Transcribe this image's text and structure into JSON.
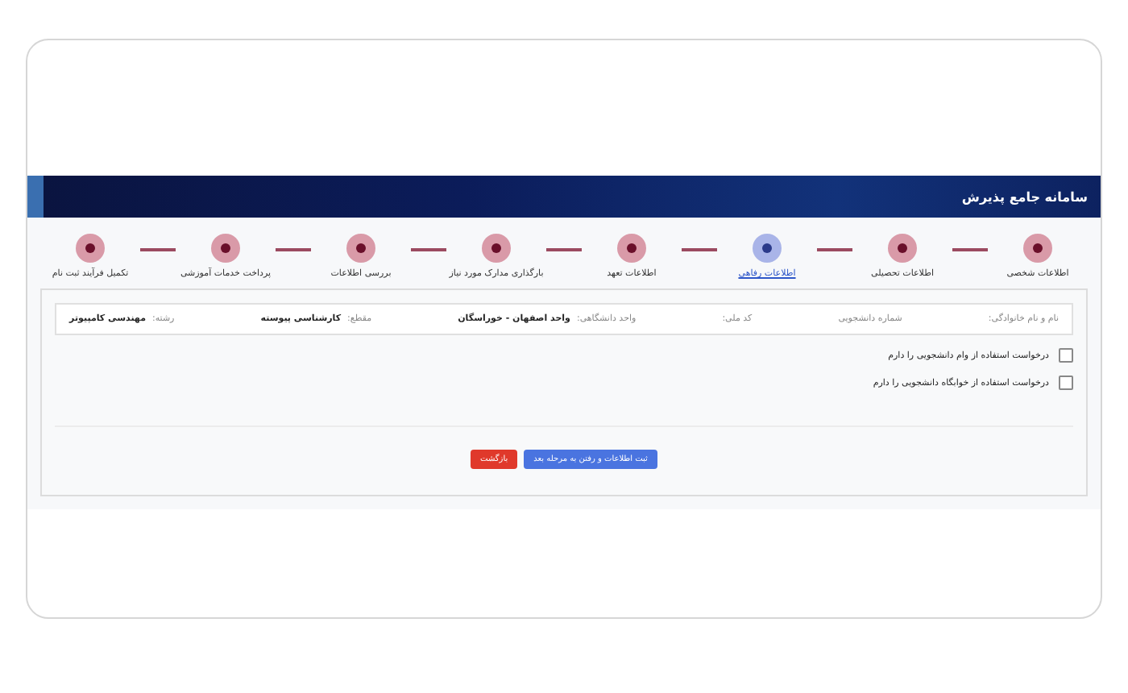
{
  "header": {
    "title": "سامانه جامع پذیرش"
  },
  "steps": [
    {
      "label": "اطلاعات شخصی",
      "selected": false
    },
    {
      "label": "اطلاعات تحصیلی",
      "selected": false
    },
    {
      "label": "اطلاعات رفاهی",
      "selected": true
    },
    {
      "label": "اطلاعات تعهد",
      "selected": false
    },
    {
      "label": "بارگذاری مدارک مورد نیاز",
      "selected": false
    },
    {
      "label": "بررسی اطلاعات",
      "selected": false
    },
    {
      "label": "پرداخت خدمات آموزشی",
      "selected": false
    },
    {
      "label": "تکمیل فرآیند ثبت نام",
      "selected": false
    }
  ],
  "student_info": [
    {
      "label": "نام و نام خانوادگی:"
    },
    {
      "label": "شماره دانشجویی"
    },
    {
      "label": "کد ملی:"
    },
    {
      "label": "واحد دانشگاهی:",
      "value": "واحد اصفهان - خوراسگان"
    },
    {
      "label": "مقطع:",
      "value": "کارشناسی پیوسته"
    },
    {
      "label": "رشته:",
      "value": "مهندسی کامپیوتر"
    }
  ],
  "requests": [
    {
      "label": "درخواست استفاده از وام دانشجویی را دارم",
      "checked": false
    },
    {
      "label": "درخواست استفاده از خوابگاه دانشجویی را دارم",
      "checked": false
    }
  ],
  "buttons": [
    {
      "kind": "primary",
      "label": "ثبت اطلاعات و رفتن به مرحله بعد"
    },
    {
      "kind": "danger",
      "label": "بازگشت"
    }
  ]
}
